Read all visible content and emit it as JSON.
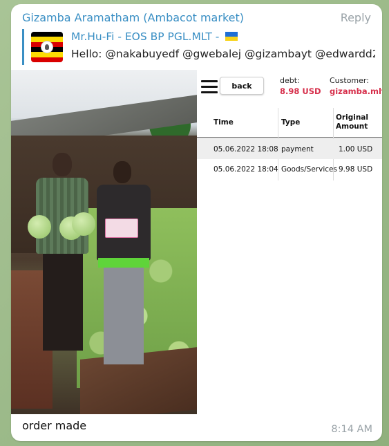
{
  "message": {
    "sender": "Gizamba Aramatham (Ambacot market)",
    "reply_label": "Reply",
    "caption": "order made",
    "time": "8:14 AM"
  },
  "quoted": {
    "title": "Mr.Hu-Fi - EOS BP PGL.MLT -",
    "text": "Hello:  @nakabuyedf @gwebalej @gizambayt @edwardd2..."
  },
  "screenshot_panel": {
    "back_label": "back",
    "debt_label": "debt:",
    "debt_value": "8.98 USD",
    "customer_label": "Customer:",
    "customer_value": "gizamba.mlt",
    "columns": [
      "Time",
      "Type",
      "Original Amount"
    ],
    "rows": [
      {
        "time": "05.06.2022 18:08",
        "type": "payment",
        "amount": "1.00 USD"
      },
      {
        "time": "05.06.2022 18:04",
        "type": "Goods/Services",
        "amount": "9.98 USD"
      }
    ]
  },
  "colors": {
    "accent": "#3a8fc4",
    "red_value": "#d62e4a"
  },
  "icons": [
    "uganda-flag-icon",
    "ukraine-flag-icon",
    "hamburger-menu-icon"
  ]
}
